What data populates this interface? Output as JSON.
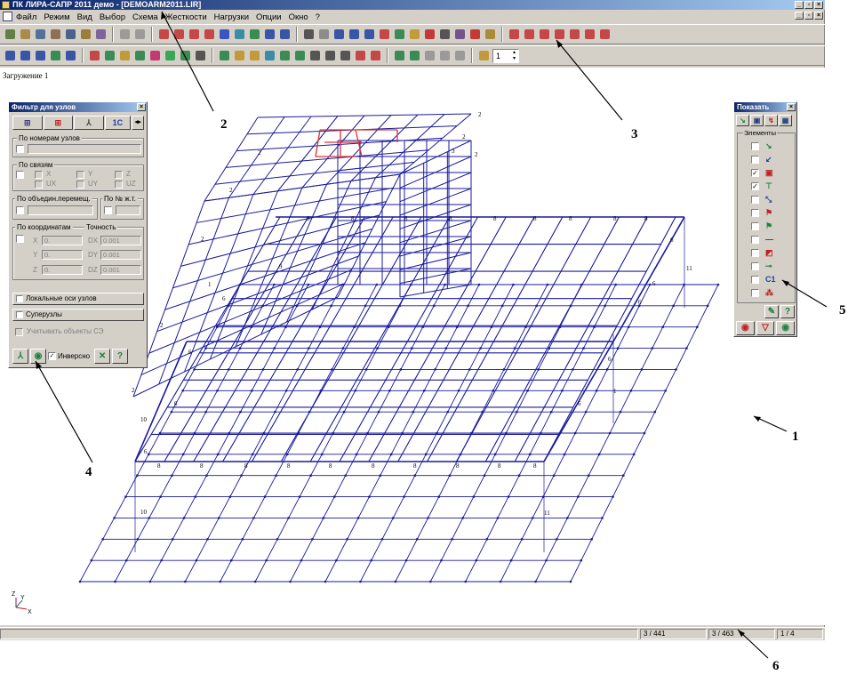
{
  "window": {
    "title": "ПК ЛИРА-САПР 2011 демо - [DEMOARM2011.LIR]",
    "controls": [
      "_",
      "▫",
      "×"
    ]
  },
  "menu": {
    "items": [
      "Файл",
      "Режим",
      "Вид",
      "Выбор",
      "Схема",
      "Жесткости",
      "Нагрузки",
      "Опции",
      "Окно",
      "?"
    ]
  },
  "toolbar": {
    "zoom_value": "1"
  },
  "workspace": {
    "load_label": "Загружение 1",
    "axis_labels": {
      "z": "Z",
      "y": "Y",
      "x": "X"
    },
    "node_labels": [
      "2",
      "6",
      "8",
      "9",
      "10",
      "11",
      "1",
      "3"
    ]
  },
  "status": {
    "cells": [
      "3 / 441",
      "3 / 463",
      "1 / 4"
    ]
  },
  "filter_panel": {
    "title": "Фильтр для узлов",
    "tabs": [
      "⊞",
      "⊞",
      "⅄",
      "1С",
      "◂▸"
    ],
    "groups": {
      "by_numbers": "По номерам узлов",
      "by_links": "По связям",
      "by_joint": "По объедин.перемещ.",
      "by_fe": "По № ж.т.",
      "by_coords": "По координатам",
      "precision": "Точность"
    },
    "links": [
      "X",
      "Y",
      "Z",
      "UX",
      "UY",
      "UZ"
    ],
    "coords": {
      "x_label": "X",
      "y_label": "Y",
      "z_label": "Z",
      "x_value": "0.",
      "y_value": "0.",
      "z_value": "0.",
      "dx_label": "DX",
      "dy_label": "DY",
      "dz_label": "DZ",
      "dx_value": "0.001",
      "dy_value": "0.001",
      "dz_value": "0.001"
    },
    "local_axes": "Локальные оси узлов",
    "supernodes": "Суперузлы",
    "consider_se": "Учитывать объекты СЭ",
    "inverse": "Инверсно"
  },
  "show_panel": {
    "title": "Показать",
    "group_label": "Элементы",
    "rows": [
      {
        "icon": "↘",
        "checked": false
      },
      {
        "icon": "↙",
        "checked": false
      },
      {
        "icon": "▣",
        "checked": true
      },
      {
        "icon": "⊤",
        "checked": true
      },
      {
        "icon": "⤡",
        "checked": false
      },
      {
        "icon": "⚑",
        "checked": false
      },
      {
        "icon": "⚑",
        "checked": false
      },
      {
        "icon": "—",
        "checked": false
      },
      {
        "icon": "◩",
        "checked": false
      },
      {
        "icon": "⊸",
        "checked": false
      },
      {
        "icon": "С1",
        "checked": false
      },
      {
        "icon": "⁂",
        "checked": false
      }
    ]
  },
  "callouts": [
    "1",
    "2",
    "3",
    "4",
    "5",
    "6"
  ],
  "colors": {
    "grid": "#1a1a9a",
    "selected": "#e03030",
    "titlebar": "#0a246a",
    "panel": "#d4d0c8"
  }
}
